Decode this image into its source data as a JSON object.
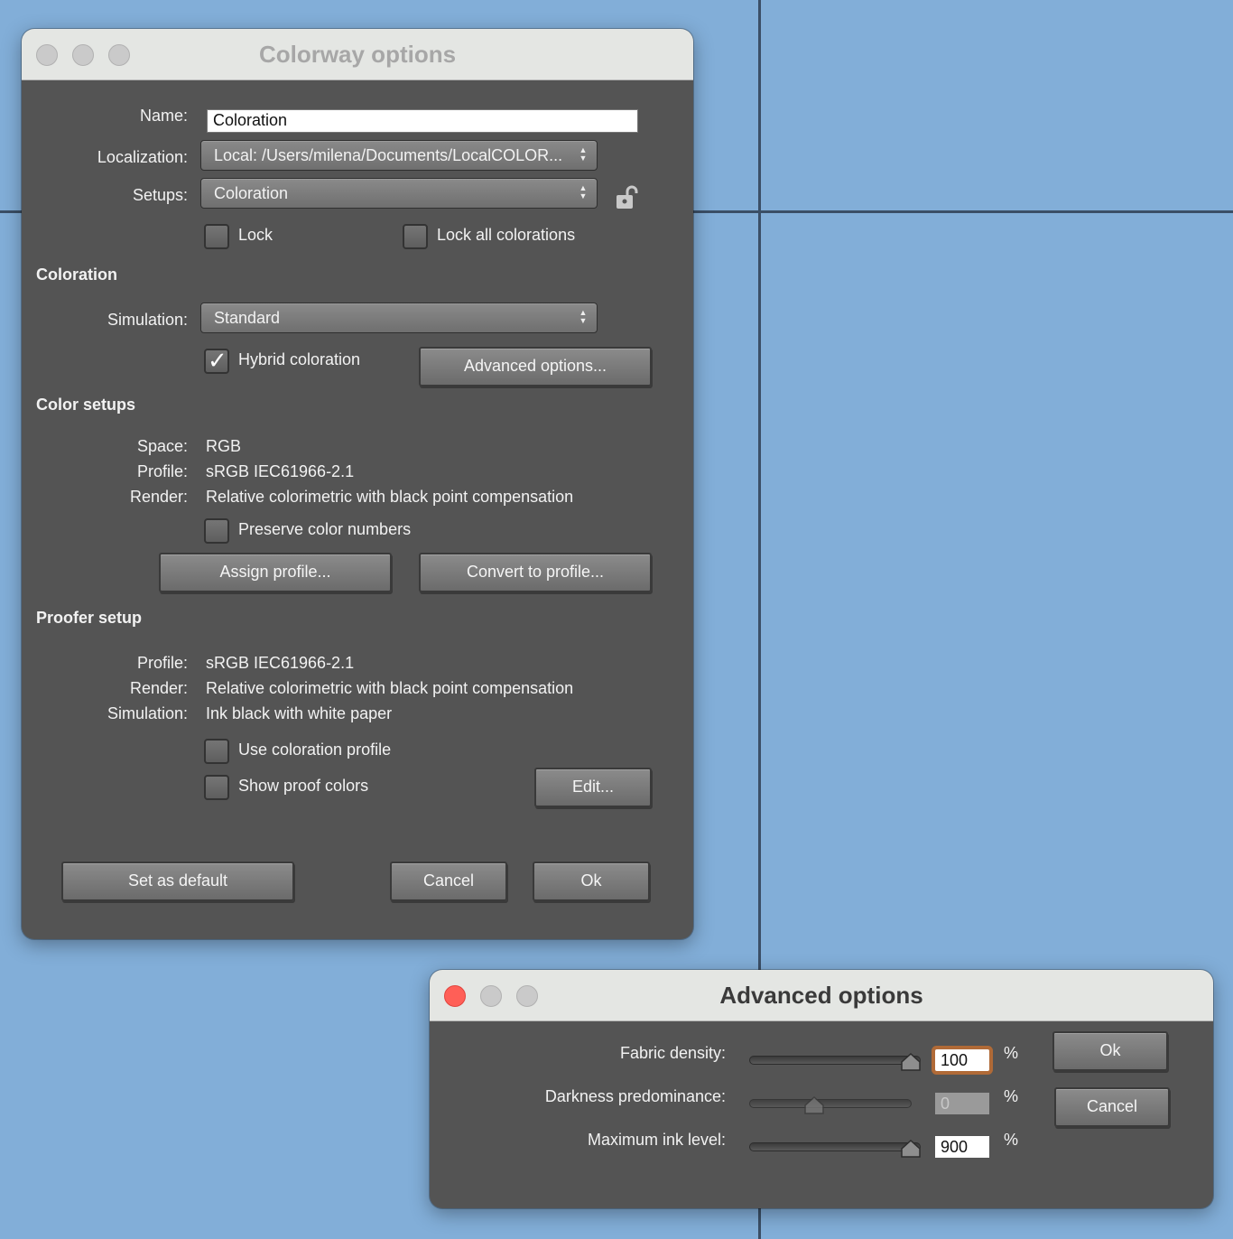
{
  "colorway_window": {
    "title": "Colorway options",
    "name_label": "Name:",
    "name_value": "Coloration",
    "localization_label": "Localization:",
    "localization_value": "Local: /Users/milena/Documents/LocalCOLOR...",
    "setups_label": "Setups:",
    "setups_value": "Coloration",
    "lock_label": "Lock",
    "lock_checked": false,
    "lock_all_label": "Lock all colorations",
    "lock_all_checked": false,
    "coloration_section": "Coloration",
    "simulation_label": "Simulation:",
    "simulation_value": "Standard",
    "hybrid_label": "Hybrid coloration",
    "hybrid_checked": true,
    "advanced_button": "Advanced options...",
    "color_setups_section": "Color setups",
    "space_label": "Space:",
    "space_value": "RGB",
    "profile_label": "Profile:",
    "profile_value": "sRGB IEC61966-2.1",
    "render_label": "Render:",
    "render_value": "Relative colorimetric with black point compensation",
    "preserve_label": "Preserve color numbers",
    "preserve_checked": false,
    "assign_button": "Assign profile...",
    "convert_button": "Convert to profile...",
    "proofer_section": "Proofer setup",
    "proof_profile_label": "Profile:",
    "proof_profile_value": "sRGB IEC61966-2.1",
    "proof_render_label": "Render:",
    "proof_render_value": "Relative colorimetric with black point compensation",
    "proof_simulation_label": "Simulation:",
    "proof_simulation_value": "Ink black with white paper",
    "use_profile_label": "Use coloration profile",
    "use_profile_checked": false,
    "show_proof_label": "Show proof colors",
    "show_proof_checked": false,
    "edit_button": "Edit...",
    "set_default_button": "Set as default",
    "cancel_button": "Cancel",
    "ok_button": "Ok"
  },
  "advanced_window": {
    "title": "Advanced options",
    "fabric_density_label": "Fabric density:",
    "fabric_density_value": "100",
    "fabric_density_level": 1.0,
    "darkness_label": "Darkness predominance:",
    "darkness_value": "0",
    "darkness_level": 0.4,
    "max_ink_label": "Maximum ink level:",
    "max_ink_value": "900",
    "max_ink_level": 1.0,
    "percent_sign": "%",
    "ok_button": "Ok",
    "cancel_button": "Cancel"
  },
  "colors": {
    "desktop": "#82aed8",
    "window_body": "#545454",
    "titlebar": "#e4e6e3",
    "close_red": "#ff5f57",
    "focus_ring": "#b06a37"
  },
  "icons": [
    "unlocked-padlock-icon",
    "checkmark-icon",
    "popup-arrows-icon",
    "slider-thumb-icon"
  ]
}
